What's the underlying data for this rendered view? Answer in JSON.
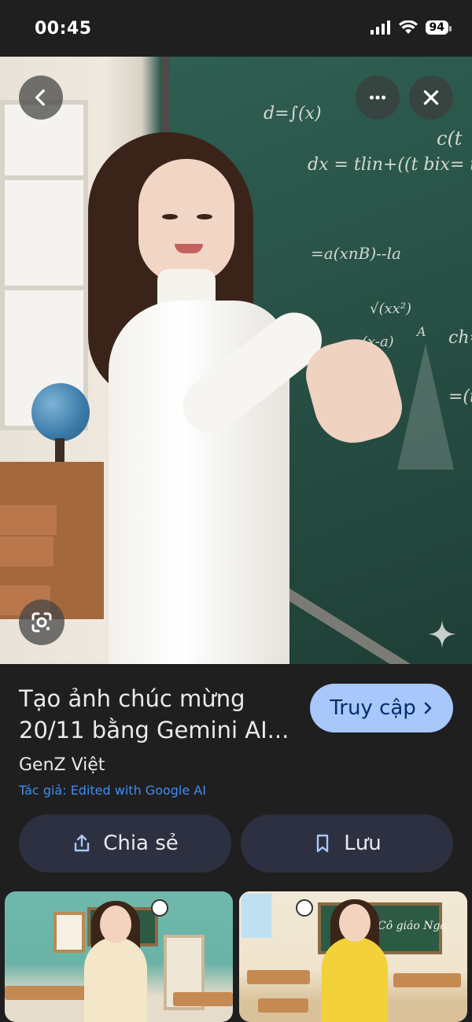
{
  "status_bar": {
    "time": "00:45",
    "battery": "94"
  },
  "hero": {
    "formulas": [
      "d=∫(x)",
      "dx = tlin+((t bix= tx",
      "=a(xnB)--la",
      "√(xx²)",
      "(x-a)",
      "c(t",
      "ch=",
      "=(t+",
      "A"
    ]
  },
  "result": {
    "title": "Tạo ảnh chúc mừng 20/11 bằng Gemini AI...",
    "visit_label": "Truy cập",
    "source_name": "GenZ Việt",
    "author_credit": "Tác giả: Edited with Google AI"
  },
  "actions": {
    "share_label": "Chia sẻ",
    "save_label": "Lưu"
  },
  "thumbnails": {
    "board_caption": "Cô giáo Nga"
  },
  "icons": [
    "back-arrow-icon",
    "more-options-icon",
    "close-icon",
    "google-lens-icon",
    "sparkle-icon",
    "chevron-right-icon",
    "share-icon",
    "bookmark-icon"
  ],
  "colors": {
    "background": "#1f1f1f",
    "accent_button": "#a8c7fa",
    "action_button": "#2c3040",
    "link": "#3f8df0"
  }
}
